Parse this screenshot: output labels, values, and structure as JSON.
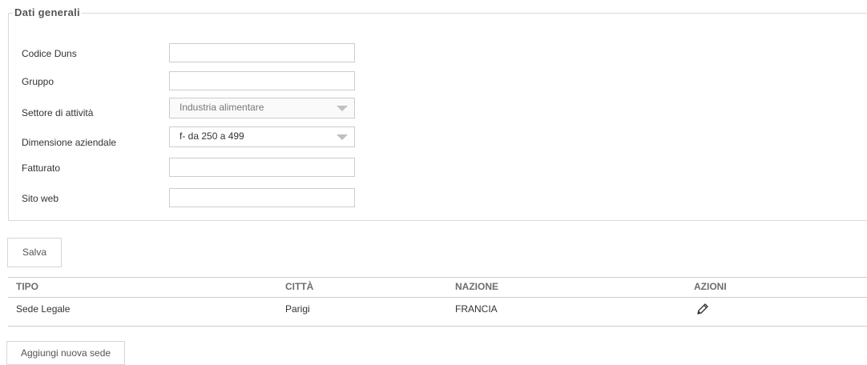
{
  "section": {
    "legend": "Dati generali"
  },
  "form": {
    "codice_duns": {
      "label": "Codice Duns",
      "value": ""
    },
    "gruppo": {
      "label": "Gruppo",
      "value": ""
    },
    "settore": {
      "label": "Settore di attività",
      "value": "Industria alimentare"
    },
    "dimensione": {
      "label": "Dimensione aziendale",
      "value": "f- da 250 a 499"
    },
    "fatturato": {
      "label": "Fatturato",
      "value": ""
    },
    "sito_web": {
      "label": "Sito web",
      "value": ""
    }
  },
  "buttons": {
    "save": "Salva",
    "add_sede": "Aggiungi nuova sede"
  },
  "table": {
    "headers": [
      "TIPO",
      "CITTÀ",
      "NAZIONE",
      "AZIONI"
    ],
    "rows": [
      [
        "Sede Legale",
        "Parigi",
        "FRANCIA"
      ]
    ]
  },
  "icons": {
    "edit": "pencil-icon",
    "dropdown": "chevron-down-icon"
  }
}
